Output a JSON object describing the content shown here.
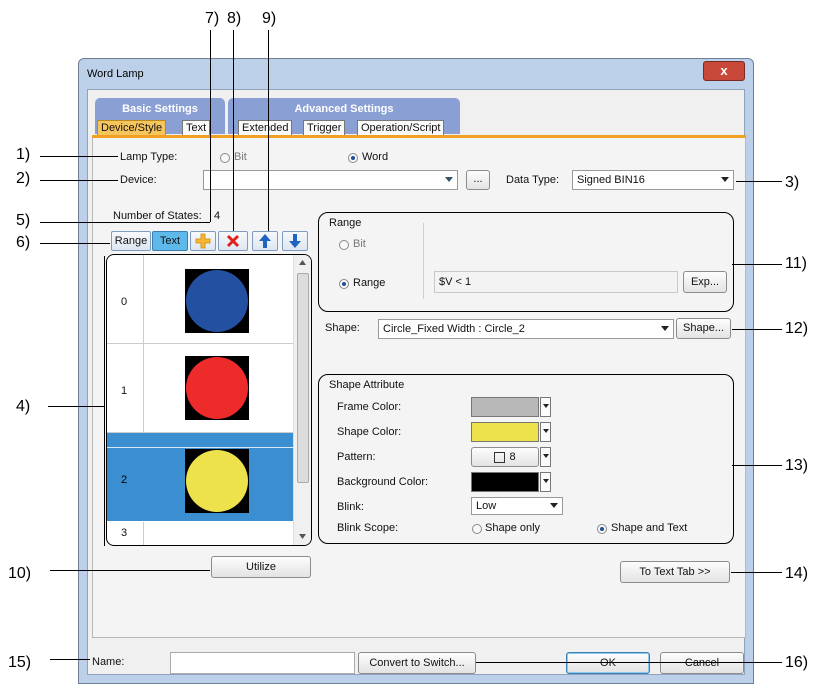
{
  "callouts": {
    "c1": "1)",
    "c2": "2)",
    "c3": "3)",
    "c4": "4)",
    "c5": "5)",
    "c6": "6)",
    "c7": "7)",
    "c8": "8)",
    "c9": "9)",
    "c10": "10)",
    "c11": "11)",
    "c12": "12)",
    "c13": "13)",
    "c14": "14)",
    "c15": "15)",
    "c16": "16)"
  },
  "window": {
    "title": "Word Lamp",
    "close": "x"
  },
  "tabs": {
    "basic": "Basic Settings",
    "advanced": "Advanced Settings",
    "device_style": "Device/Style",
    "text": "Text",
    "extended": "Extended",
    "trigger": "Trigger",
    "operation_script": "Operation/Script"
  },
  "form": {
    "lamp_type_label": "Lamp Type:",
    "bit_label": "Bit",
    "word_label": "Word",
    "device_label": "Device:",
    "device_value": "",
    "browse": "...",
    "data_type_label": "Data Type:",
    "data_type_value": "Signed BIN16",
    "num_states_label": "Number of States:",
    "num_states_value": "4"
  },
  "toolbar": {
    "range": "Range",
    "text": "Text"
  },
  "states": [
    {
      "index": "0",
      "color": "#2350a0",
      "selected": false
    },
    {
      "index": "1",
      "color": "#ee2b2b",
      "selected": false
    },
    {
      "index": "2",
      "color": "#ede14c",
      "selected": true
    },
    {
      "index": "3",
      "color": "",
      "selected": false
    }
  ],
  "range": {
    "group_label": "Range",
    "bit": "Bit",
    "range": "Range",
    "expression": "$V < 1",
    "exp_button": "Exp..."
  },
  "shape": {
    "label": "Shape:",
    "value": "Circle_Fixed Width : Circle_2",
    "button": "Shape..."
  },
  "attributes": {
    "group_label": "Shape Attribute",
    "frame_color_label": "Frame Color:",
    "frame_color": "#b8b8b8",
    "shape_color_label": "Shape Color:",
    "shape_color": "#ede14c",
    "pattern_label": "Pattern:",
    "pattern_value": "8",
    "background_color_label": "Background Color:",
    "background_color": "#000000",
    "blink_label": "Blink:",
    "blink_value": "Low",
    "blink_scope_label": "Blink Scope:",
    "shape_only": "Shape only",
    "shape_and_text": "Shape and Text"
  },
  "buttons": {
    "utilize": "Utilize",
    "to_text_tab": "To Text Tab >>",
    "convert": "Convert to Switch...",
    "ok": "OK",
    "cancel": "Cancel"
  },
  "name": {
    "label": "Name:",
    "value": ""
  }
}
